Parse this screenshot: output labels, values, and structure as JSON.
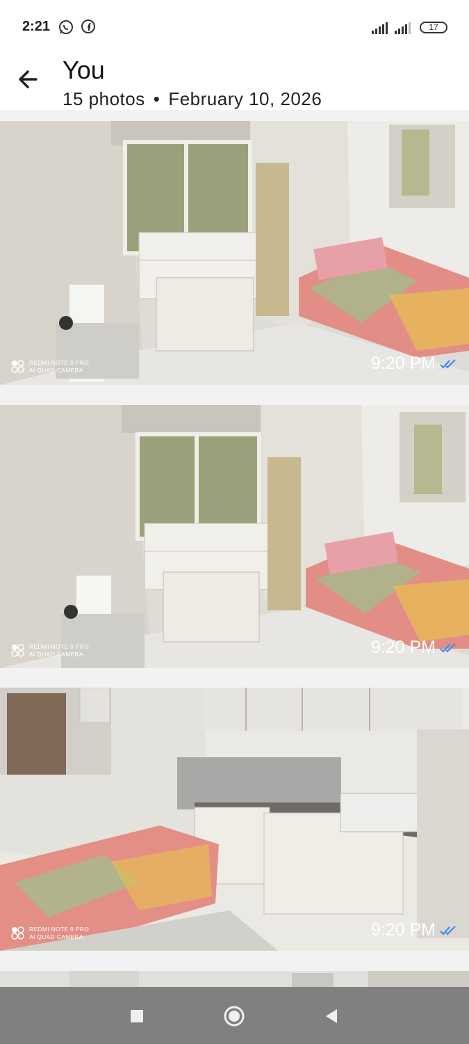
{
  "status_bar": {
    "time": "2:21",
    "battery": "17"
  },
  "header": {
    "title": "You",
    "photo_count": "15 photos",
    "separator": "•",
    "date": "February 10, 2026"
  },
  "photos": [
    {
      "camera_line1": "REDMI NOTE 9 PRO",
      "camera_line2": "AI QUAD CAMERA",
      "time": "9:20 PM"
    },
    {
      "camera_line1": "REDMI NOTE 9 PRO",
      "camera_line2": "AI QUAD CAMERA",
      "time": "9:20 PM"
    },
    {
      "camera_line1": "REDMI NOTE 9 PRO",
      "camera_line2": "AI QUAD CAMERA",
      "time": "9:20 PM"
    }
  ],
  "icons": {
    "back": "arrow-left-icon",
    "whatsapp": "whatsapp-icon",
    "facebook": "facebook-icon",
    "read": "double-check-icon",
    "nav_recent": "square-icon",
    "nav_home": "circle-icon",
    "nav_back": "triangle-back-icon"
  },
  "colors": {
    "read_check": "#3d8cf0",
    "nav_bar": "#808080"
  }
}
